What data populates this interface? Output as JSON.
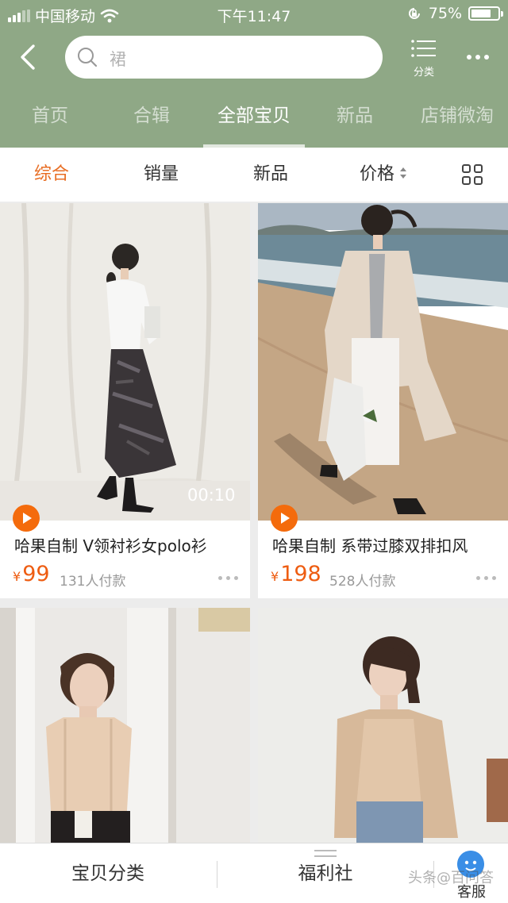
{
  "status": {
    "carrier": "中国移动",
    "time": "下午11:47",
    "battery": "75%",
    "battery_level": 0.75
  },
  "header": {
    "search_placeholder": "裙",
    "category_label": "分类",
    "tabs": [
      {
        "label": "首页"
      },
      {
        "label": "合辑"
      },
      {
        "label": "全部宝贝"
      },
      {
        "label": "新品"
      },
      {
        "label": "店铺微淘"
      }
    ],
    "active_tab": "全部宝贝"
  },
  "sort": {
    "items": [
      {
        "label": "综合"
      },
      {
        "label": "销量"
      },
      {
        "label": "新品"
      },
      {
        "label": "价格"
      }
    ],
    "active": "综合"
  },
  "products": [
    {
      "title": "哈果自制 V领衬衫女polo衫",
      "currency": "¥",
      "price": "99",
      "sold": "131人付款",
      "video_duration": "00:10"
    },
    {
      "title": "哈果自制 系带过膝双排扣风",
      "currency": "¥",
      "price": "198",
      "sold": "528人付款",
      "video_duration": ""
    },
    {
      "title": "",
      "currency": "",
      "price": "",
      "sold": ""
    },
    {
      "title": "",
      "currency": "",
      "price": "",
      "sold": ""
    }
  ],
  "bottom_bar": {
    "category": "宝贝分类",
    "welfare": "福利社",
    "service": "客服",
    "watermark": "头条@百问答"
  },
  "colors": {
    "header_bg": "#8fa886",
    "accent": "#e86e24",
    "price": "#ee5d12",
    "play_badge": "#f46b0c"
  }
}
